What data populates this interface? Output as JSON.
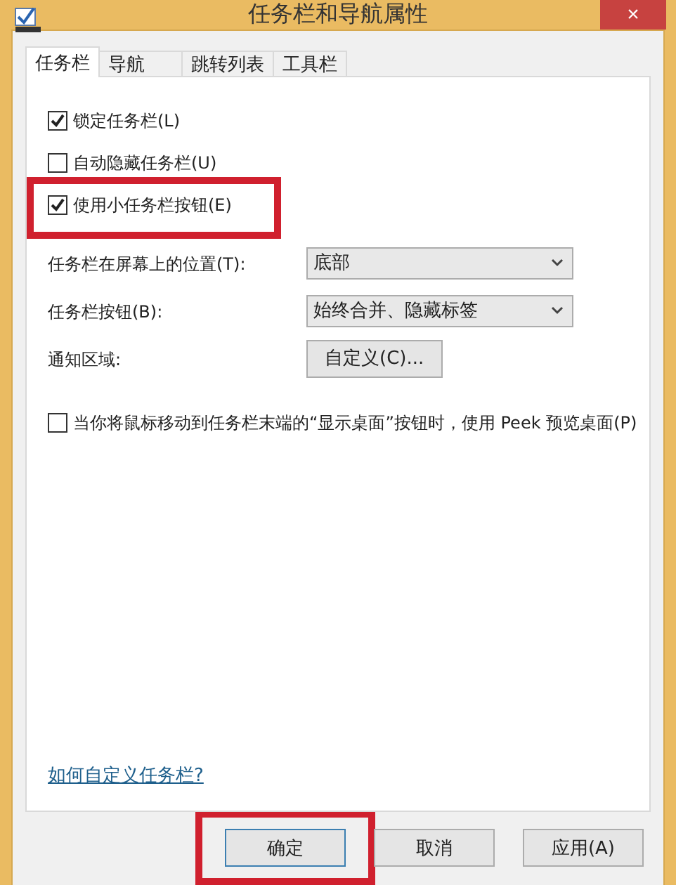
{
  "window": {
    "title": "任务栏和导航属性",
    "close": "×"
  },
  "tabs": [
    {
      "label": "任务栏",
      "selected": true
    },
    {
      "label": "导航",
      "selected": false
    },
    {
      "label": "跳转列表",
      "selected": false
    },
    {
      "label": "工具栏",
      "selected": false
    }
  ],
  "options": [
    {
      "kind": "checkbox",
      "label": "锁定任务栏(L)",
      "checked": true,
      "highlighted": false
    },
    {
      "kind": "checkbox",
      "label": "自动隐藏任务栏(U)",
      "checked": false,
      "highlighted": false
    },
    {
      "kind": "checkbox",
      "label": "使用小任务栏按钮(E)",
      "checked": true,
      "highlighted": true
    },
    {
      "kind": "select",
      "label": "任务栏在屏幕上的位置(T):",
      "value": "底部"
    },
    {
      "kind": "select",
      "label": "任务栏按钮(B):",
      "value": "始终合并、隐藏标签"
    },
    {
      "kind": "button",
      "label": "通知区域:",
      "value": "自定义(C)..."
    },
    {
      "kind": "checkbox",
      "label": "当你将鼠标移动到任务栏末端的“显示桌面”按钮时，使用 Peek 预览桌面(P)",
      "checked": false,
      "highlighted": false
    }
  ],
  "help_link": "如何自定义任务栏?",
  "buttons": [
    {
      "label": "确定",
      "highlighted": true
    },
    {
      "label": "取消",
      "highlighted": false
    },
    {
      "label": "应用(A)",
      "highlighted": false
    }
  ]
}
